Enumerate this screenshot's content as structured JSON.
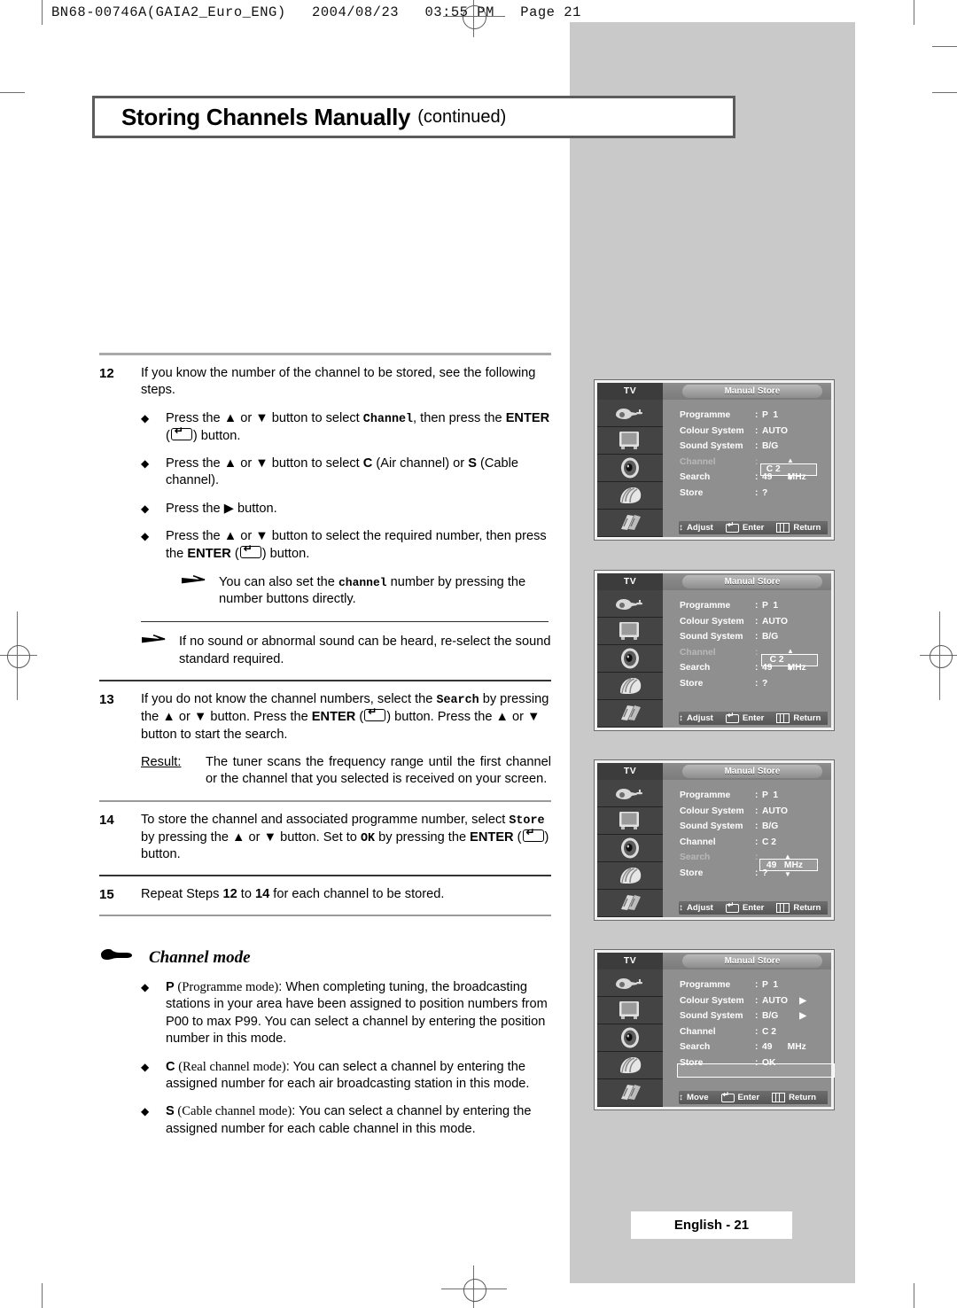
{
  "print_header": "BN68-00746A(GAIA2_Euro_ENG)   2004/08/23   03:55 PM   Page 21",
  "title": {
    "main": "Storing Channels Manually",
    "sub": "(continued)"
  },
  "steps": [
    {
      "num": "12",
      "text": "If you know the number of the channel to be stored, see the following steps.",
      "bullets": [
        {
          "mark": "◆",
          "parts": [
            {
              "t": "Press the ",
              "s": "n"
            },
            {
              "t": "▲",
              "s": "n"
            },
            {
              "t": " or ",
              "s": "n"
            },
            {
              "t": "▼",
              "s": "n"
            },
            {
              "t": " button to select ",
              "s": "n"
            },
            {
              "t": "Channel",
              "s": "mono"
            },
            {
              "t": ", then press the ",
              "s": "n"
            },
            {
              "t": "ENTER",
              "s": "b"
            },
            {
              "t": " (",
              "s": "n"
            },
            {
              "t": "KEY",
              "s": "key"
            },
            {
              "t": ") button.",
              "s": "n"
            }
          ]
        },
        {
          "mark": "◆",
          "parts": [
            {
              "t": "Press the ",
              "s": "n"
            },
            {
              "t": "▲",
              "s": "n"
            },
            {
              "t": " or ",
              "s": "n"
            },
            {
              "t": "▼",
              "s": "n"
            },
            {
              "t": " button to select ",
              "s": "n"
            },
            {
              "t": "C",
              "s": "b"
            },
            {
              "t": " (Air channel) or ",
              "s": "n"
            },
            {
              "t": "S",
              "s": "b"
            },
            {
              "t": " (Cable channel).",
              "s": "n"
            }
          ]
        },
        {
          "mark": "◆",
          "parts": [
            {
              "t": "Press the ",
              "s": "n"
            },
            {
              "t": "▶",
              "s": "n"
            },
            {
              "t": " button.",
              "s": "n"
            }
          ]
        },
        {
          "mark": "◆",
          "parts": [
            {
              "t": "Press the ",
              "s": "n"
            },
            {
              "t": "▲",
              "s": "n"
            },
            {
              "t": " or ",
              "s": "n"
            },
            {
              "t": "▼",
              "s": "n"
            },
            {
              "t": " button to select the required number, then press the ",
              "s": "n"
            },
            {
              "t": "ENTER",
              "s": "b"
            },
            {
              "t": " (",
              "s": "n"
            },
            {
              "t": "KEY",
              "s": "key"
            },
            {
              "t": ") button.",
              "s": "n"
            }
          ]
        }
      ]
    }
  ],
  "note_1": "You can also set the channel number by pressing the number buttons directly.",
  "note_1_mono_word": "channel",
  "note_2": "If no sound or abnormal sound can be heard, re-select the sound standard required.",
  "step13": {
    "num": "13",
    "parts": [
      {
        "t": "If you do not know the channel numbers, select the ",
        "s": "n"
      },
      {
        "t": "Search",
        "s": "mono"
      },
      {
        "t": " by pressing the ",
        "s": "n"
      },
      {
        "t": "▲",
        "s": "n"
      },
      {
        "t": " or ",
        "s": "n"
      },
      {
        "t": "▼",
        "s": "n"
      },
      {
        "t": " button. Press the ",
        "s": "n"
      },
      {
        "t": "ENTER",
        "s": "b"
      },
      {
        "t": " (",
        "s": "n"
      },
      {
        "t": "KEY",
        "s": "key"
      },
      {
        "t": ") button. Press the ",
        "s": "n"
      },
      {
        "t": "▲",
        "s": "n"
      },
      {
        "t": " or ",
        "s": "n"
      },
      {
        "t": "▼",
        "s": "n"
      },
      {
        "t": " button to start the search.",
        "s": "n"
      }
    ]
  },
  "result": {
    "label": "Result:",
    "text": "The tuner scans the frequency range until the first channel or the channel that you selected is received on your screen."
  },
  "step14": {
    "num": "14",
    "parts": [
      {
        "t": "To store the channel and associated programme number, select ",
        "s": "n"
      },
      {
        "t": "Store",
        "s": "mono"
      },
      {
        "t": " by pressing the ",
        "s": "n"
      },
      {
        "t": "▲",
        "s": "n"
      },
      {
        "t": " or ",
        "s": "n"
      },
      {
        "t": "▼",
        "s": "n"
      },
      {
        "t": " button. Set to ",
        "s": "n"
      },
      {
        "t": "OK",
        "s": "mono"
      },
      {
        "t": " by pressing the ",
        "s": "n"
      },
      {
        "t": "ENTER",
        "s": "b"
      },
      {
        "t": " (",
        "s": "n"
      },
      {
        "t": "KEY",
        "s": "key"
      },
      {
        "t": ") button.",
        "s": "n"
      }
    ]
  },
  "step15": {
    "num": "15",
    "parts": [
      {
        "t": "Repeat Steps ",
        "s": "n"
      },
      {
        "t": "12",
        "s": "b"
      },
      {
        "t": " to ",
        "s": "n"
      },
      {
        "t": "14",
        "s": "b"
      },
      {
        "t": " for each channel to be stored.",
        "s": "n"
      }
    ]
  },
  "channel_mode": {
    "hand_icon": "pointing-hand-icon",
    "heading": "Channel mode",
    "bullets": [
      {
        "mark": "◆",
        "parts": [
          {
            "t": "P",
            "s": "b"
          },
          {
            "t": " (Programme mode)",
            "s": "serif"
          },
          {
            "t": ": When completing tuning, the broadcasting stations in your area have been assigned to position numbers from P00 to max P99. You can select a channel by entering the position number in this mode.",
            "s": "n"
          }
        ]
      },
      {
        "mark": "◆",
        "parts": [
          {
            "t": "C",
            "s": "b"
          },
          {
            "t": " (Real channel mode)",
            "s": "serif"
          },
          {
            "t": ": You can select a channel by entering the assigned number for each air broadcasting station in this mode.",
            "s": "n"
          }
        ]
      },
      {
        "mark": "◆",
        "parts": [
          {
            "t": "S",
            "s": "b"
          },
          {
            "t": " (Cable channel mode)",
            "s": "serif"
          },
          {
            "t": ": You can select a channel by entering the assigned number for each cable channel in this mode.",
            "s": "n"
          }
        ]
      }
    ]
  },
  "osd_common": {
    "source_label": "TV",
    "menu_title": "Manual Store",
    "icons": [
      "antenna-plug-icon",
      "tv-set-icon",
      "speaker-icon",
      "picture-setup-icon",
      "features-icon"
    ],
    "labels": {
      "programme": "Programme",
      "colour_system": "Colour System",
      "sound_system": "Sound System",
      "channel": "Channel",
      "search": "Search",
      "store": "Store"
    },
    "footer_adjust": "Adjust",
    "footer_move": "Move",
    "footer_enter": "Enter",
    "footer_return": "Return"
  },
  "osd_panels": [
    {
      "id": "osd-panel-1",
      "values": {
        "programme": "P  1",
        "colour_system": "AUTO",
        "sound_system": "B/G",
        "channel": "C 2",
        "search": "49      MHz",
        "store": "?"
      },
      "highlight": "channel",
      "highlight_value": "  C 2",
      "dim_row": "channel",
      "footer_first": "Adjust",
      "arrows": []
    },
    {
      "id": "osd-panel-2",
      "values": {
        "programme": "P  1",
        "colour_system": "AUTO",
        "sound_system": "B/G",
        "channel": "C 2",
        "search": "49      MHz",
        "store": "?"
      },
      "highlight": "channel",
      "highlight_value": "   C 2",
      "dim_row": "channel",
      "footer_first": "Adjust",
      "arrows": []
    },
    {
      "id": "osd-panel-3",
      "values": {
        "programme": "P  1",
        "colour_system": "AUTO",
        "sound_system": "B/G",
        "channel": "C 2",
        "search": "49   MHz",
        "store": "?"
      },
      "highlight": "search",
      "highlight_value": " 49   MHz",
      "dim_row": "search",
      "footer_first": "Adjust",
      "arrows": []
    },
    {
      "id": "osd-panel-4",
      "values": {
        "programme": "P  1",
        "colour_system": "AUTO",
        "sound_system": "B/G",
        "channel": "C 2",
        "search": "49      MHz",
        "store": "OK"
      },
      "highlight": "store",
      "highlight_value": "",
      "dim_row": "",
      "footer_first": "Move",
      "arrows": [
        "colour_system",
        "sound_system"
      ]
    }
  ],
  "page_footer": "English - 21"
}
